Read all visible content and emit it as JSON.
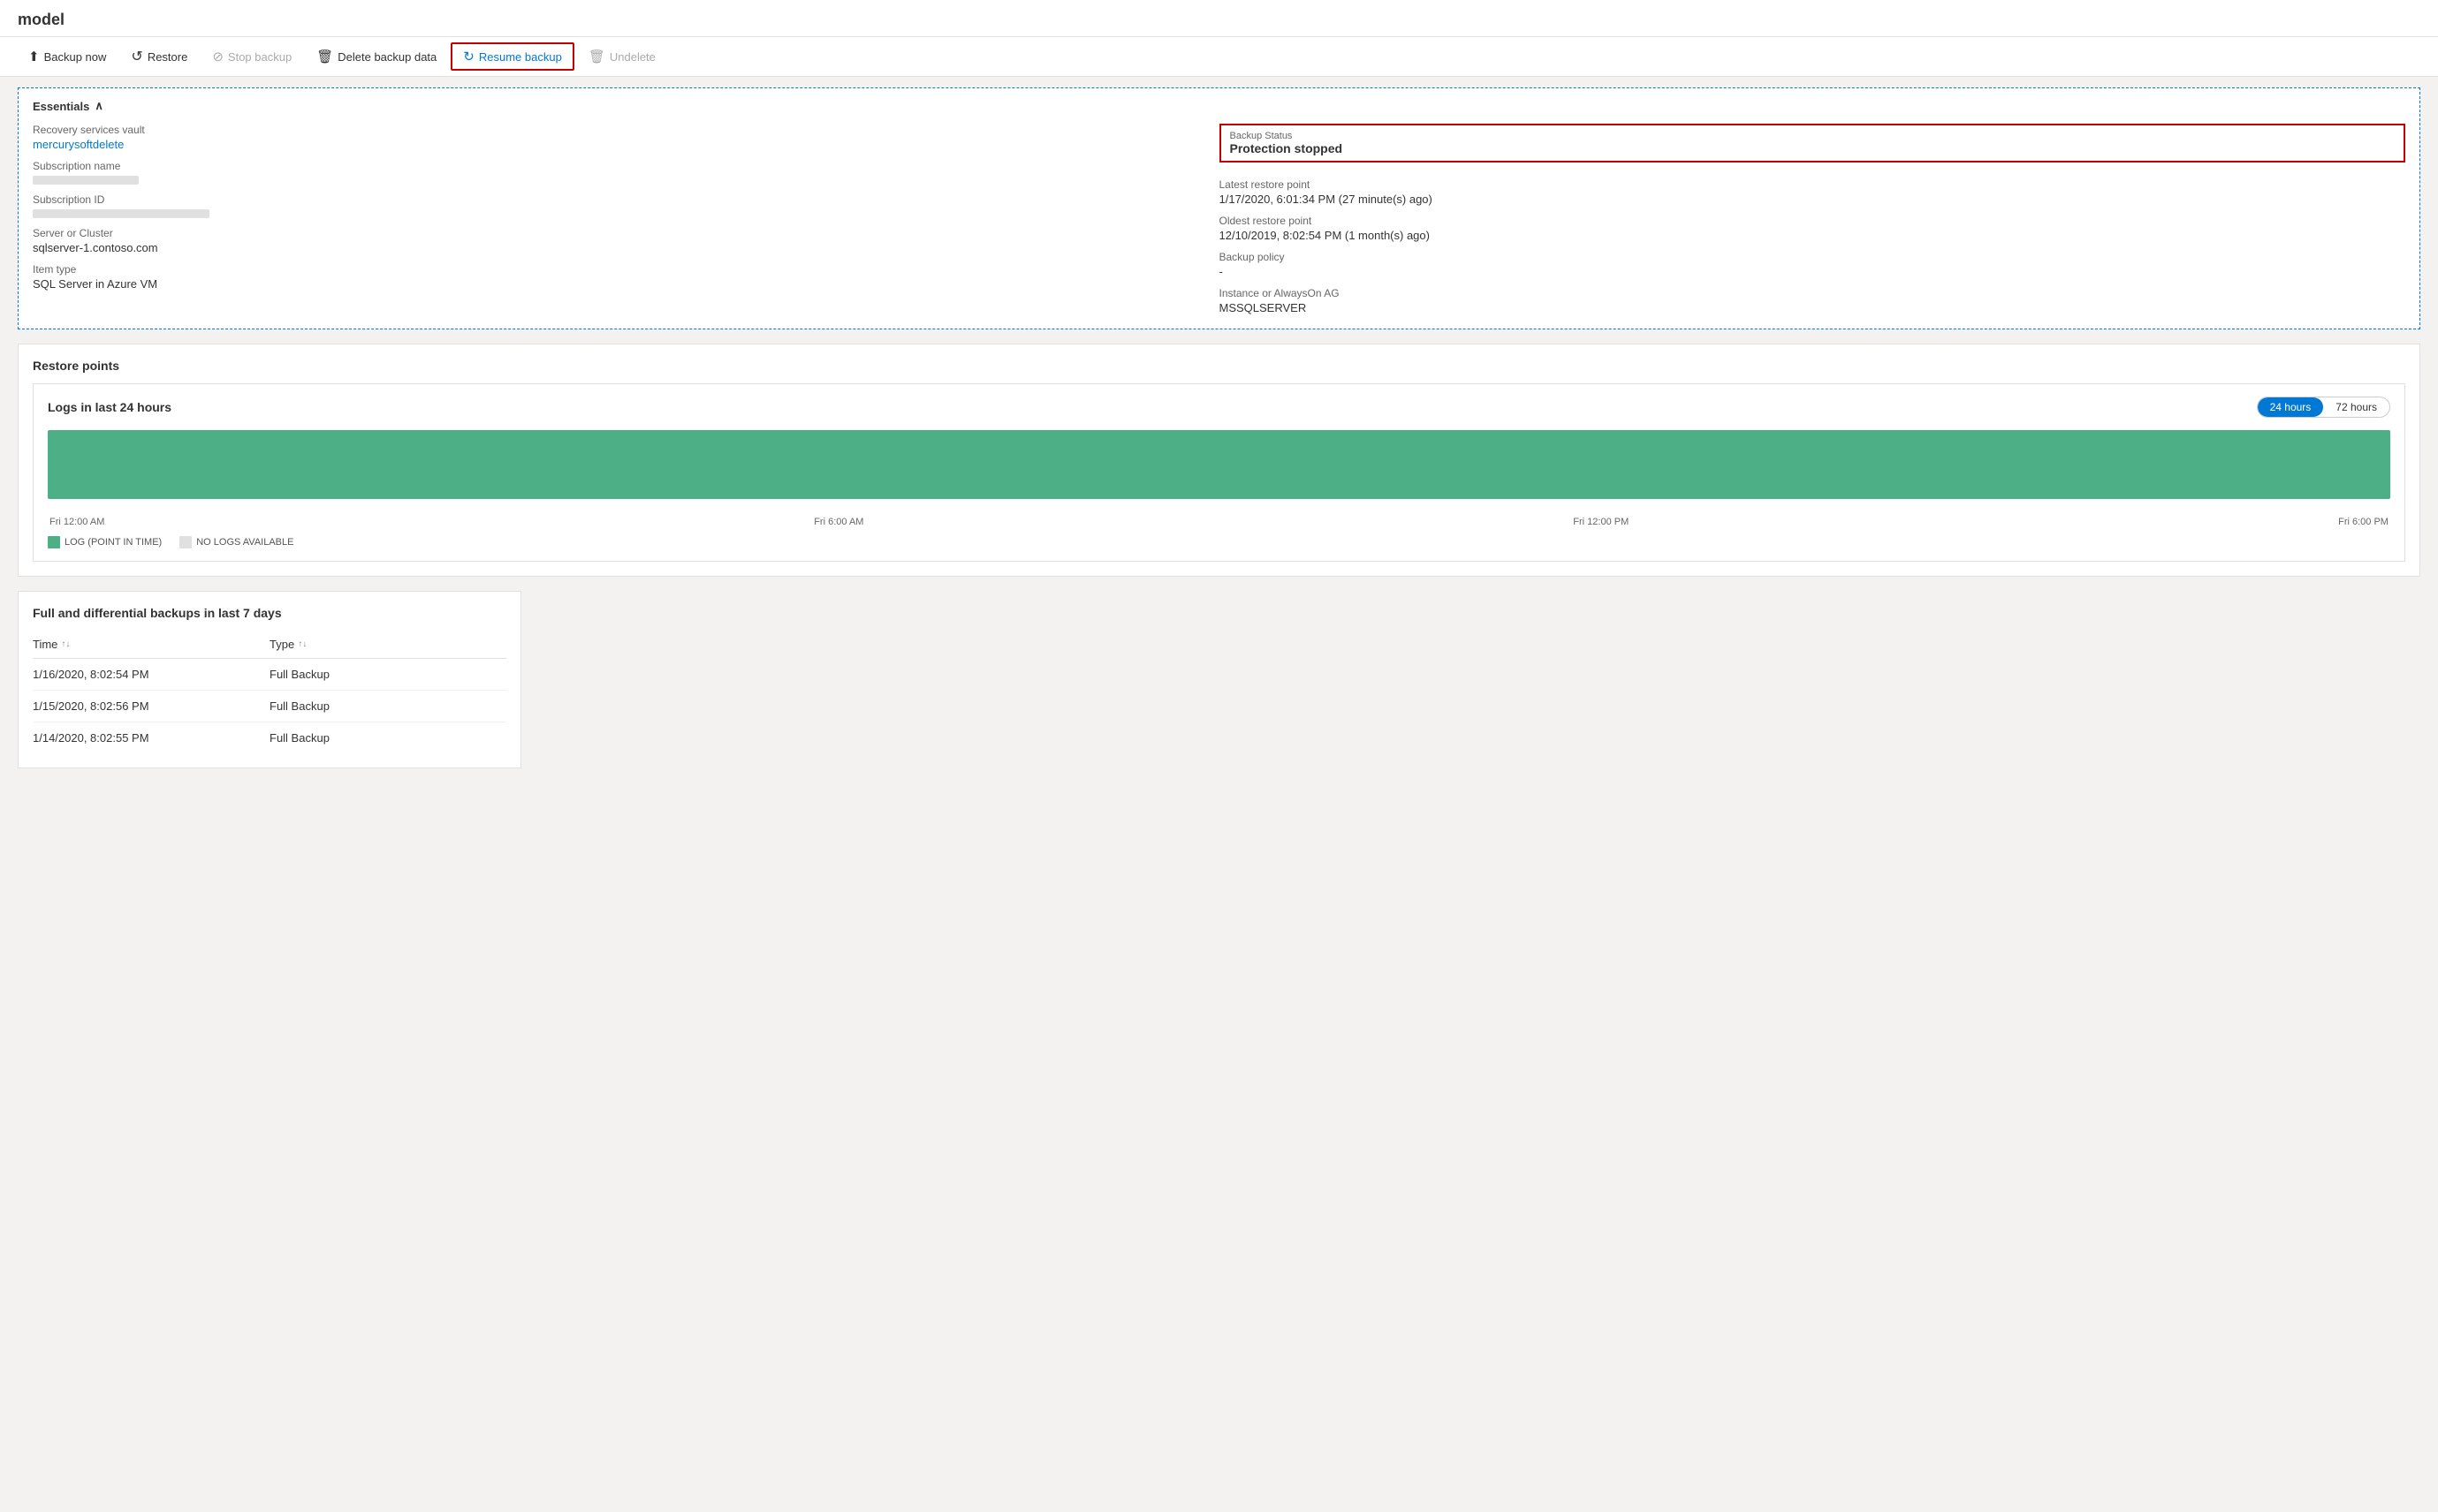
{
  "page": {
    "title": "model"
  },
  "toolbar": {
    "buttons": [
      {
        "id": "backup-now",
        "label": "Backup now",
        "icon": "⬆",
        "disabled": false,
        "highlighted": false
      },
      {
        "id": "restore",
        "label": "Restore",
        "icon": "↺",
        "disabled": false,
        "highlighted": false
      },
      {
        "id": "stop-backup",
        "label": "Stop backup",
        "icon": "⊘",
        "disabled": true,
        "highlighted": false
      },
      {
        "id": "delete-backup-data",
        "label": "Delete backup data",
        "icon": "🗑",
        "disabled": false,
        "highlighted": false
      },
      {
        "id": "resume-backup",
        "label": "Resume backup",
        "icon": "↻",
        "disabled": false,
        "highlighted": true
      },
      {
        "id": "undelete",
        "label": "Undelete",
        "icon": "🗑",
        "disabled": true,
        "highlighted": false
      }
    ]
  },
  "essentials": {
    "header": "Essentials",
    "left": {
      "recovery_vault_label": "Recovery services vault",
      "recovery_vault_value": "mercurysoftdelete",
      "subscription_name_label": "Subscription name",
      "subscription_id_label": "Subscription ID",
      "server_cluster_label": "Server or Cluster",
      "server_cluster_value": "sqlserver-1.contoso.com",
      "item_type_label": "Item type",
      "item_type_value": "SQL Server in Azure VM"
    },
    "right": {
      "backup_status_label": "Backup Status",
      "backup_status_value": "Protection stopped",
      "latest_restore_label": "Latest restore point",
      "latest_restore_value": "1/17/2020, 6:01:34 PM (27 minute(s) ago)",
      "oldest_restore_label": "Oldest restore point",
      "oldest_restore_value": "12/10/2019, 8:02:54 PM (1 month(s) ago)",
      "backup_policy_label": "Backup policy",
      "backup_policy_value": "-",
      "instance_label": "Instance or AlwaysOn AG",
      "instance_value": "MSSQLSERVER"
    }
  },
  "restore_points": {
    "section_title": "Restore points",
    "logs_card": {
      "title": "Logs in last 24 hours",
      "time_options": [
        {
          "label": "24 hours",
          "active": true
        },
        {
          "label": "72 hours",
          "active": false
        }
      ],
      "chart_labels": [
        "Fri 12:00 AM",
        "Fri 6:00 AM",
        "Fri 12:00 PM",
        "Fri 6:00 PM"
      ],
      "legend": [
        {
          "label": "LOG (POINT IN TIME)",
          "color": "#4caf86"
        },
        {
          "label": "NO LOGS AVAILABLE",
          "color": "#e0e0e0"
        }
      ]
    }
  },
  "full_diff_section": {
    "title": "Full and differential backups in last 7 days",
    "columns": [
      {
        "label": "Time"
      },
      {
        "label": "Type"
      }
    ],
    "rows": [
      {
        "time": "1/16/2020, 8:02:54 PM",
        "type": "Full Backup"
      },
      {
        "time": "1/15/2020, 8:02:56 PM",
        "type": "Full Backup"
      },
      {
        "time": "1/14/2020, 8:02:55 PM",
        "type": "Full Backup"
      }
    ]
  }
}
